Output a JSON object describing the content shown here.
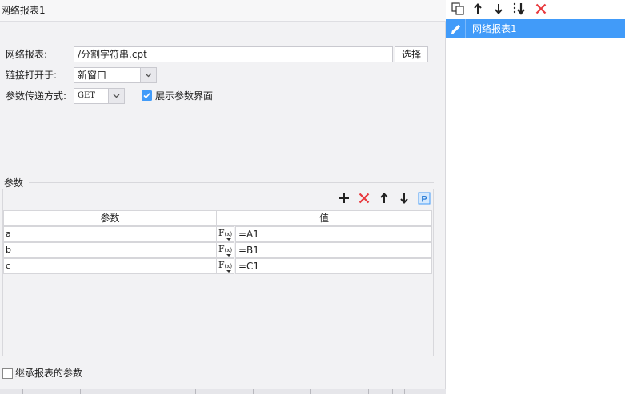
{
  "left_panel": {
    "title": "网络报表1",
    "report_label": "网络报表:",
    "report_value": "/分割字符串.cpt",
    "select_button": "选择",
    "open_in_label": "链接打开于:",
    "open_in_value": "新窗口",
    "method_label": "参数传递方式:",
    "method_value": "GET",
    "show_param_ui_label": "展示参数界面",
    "show_param_ui_checked": true,
    "params": {
      "group_title": "参数",
      "col_name": "参数",
      "col_value": "值",
      "rows": [
        {
          "name": "a",
          "value": "=A1"
        },
        {
          "name": "b",
          "value": "=B1"
        },
        {
          "name": "c",
          "value": "=C1"
        }
      ]
    },
    "inherit_label": "继承报表的参数",
    "inherit_checked": false
  },
  "right_panel": {
    "items": [
      {
        "label": "网络报表1",
        "selected": true
      }
    ]
  },
  "colors": {
    "accent": "#419bf9",
    "delete": "#e8383d"
  }
}
